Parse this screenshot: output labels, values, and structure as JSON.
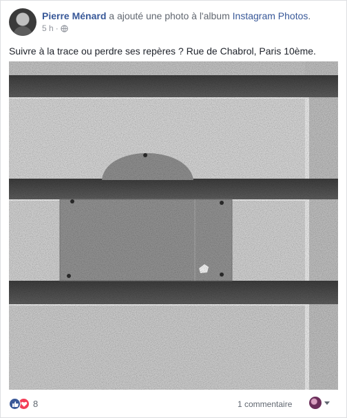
{
  "post": {
    "author": "Pierre Ménard",
    "action_text": " a ajouté une photo à l'album ",
    "album_name": "Instagram Photos",
    "album_suffix": ".",
    "time": "5 h",
    "time_sep": "·",
    "privacy_icon": "globe-icon",
    "caption": "Suivre à la trace ou perdre ses repères ? Rue de Chabrol, Paris 10ème."
  },
  "footer": {
    "reaction_icons": [
      "like-icon",
      "love-icon"
    ],
    "reaction_count": "8",
    "comments_label": "1 commentaire",
    "viewer_icon": "avatar",
    "dropdown_icon": "caret-down-icon"
  },
  "colors": {
    "link": "#385898",
    "meta": "#90949c",
    "like": "#3b5998",
    "love": "#f33e58"
  }
}
